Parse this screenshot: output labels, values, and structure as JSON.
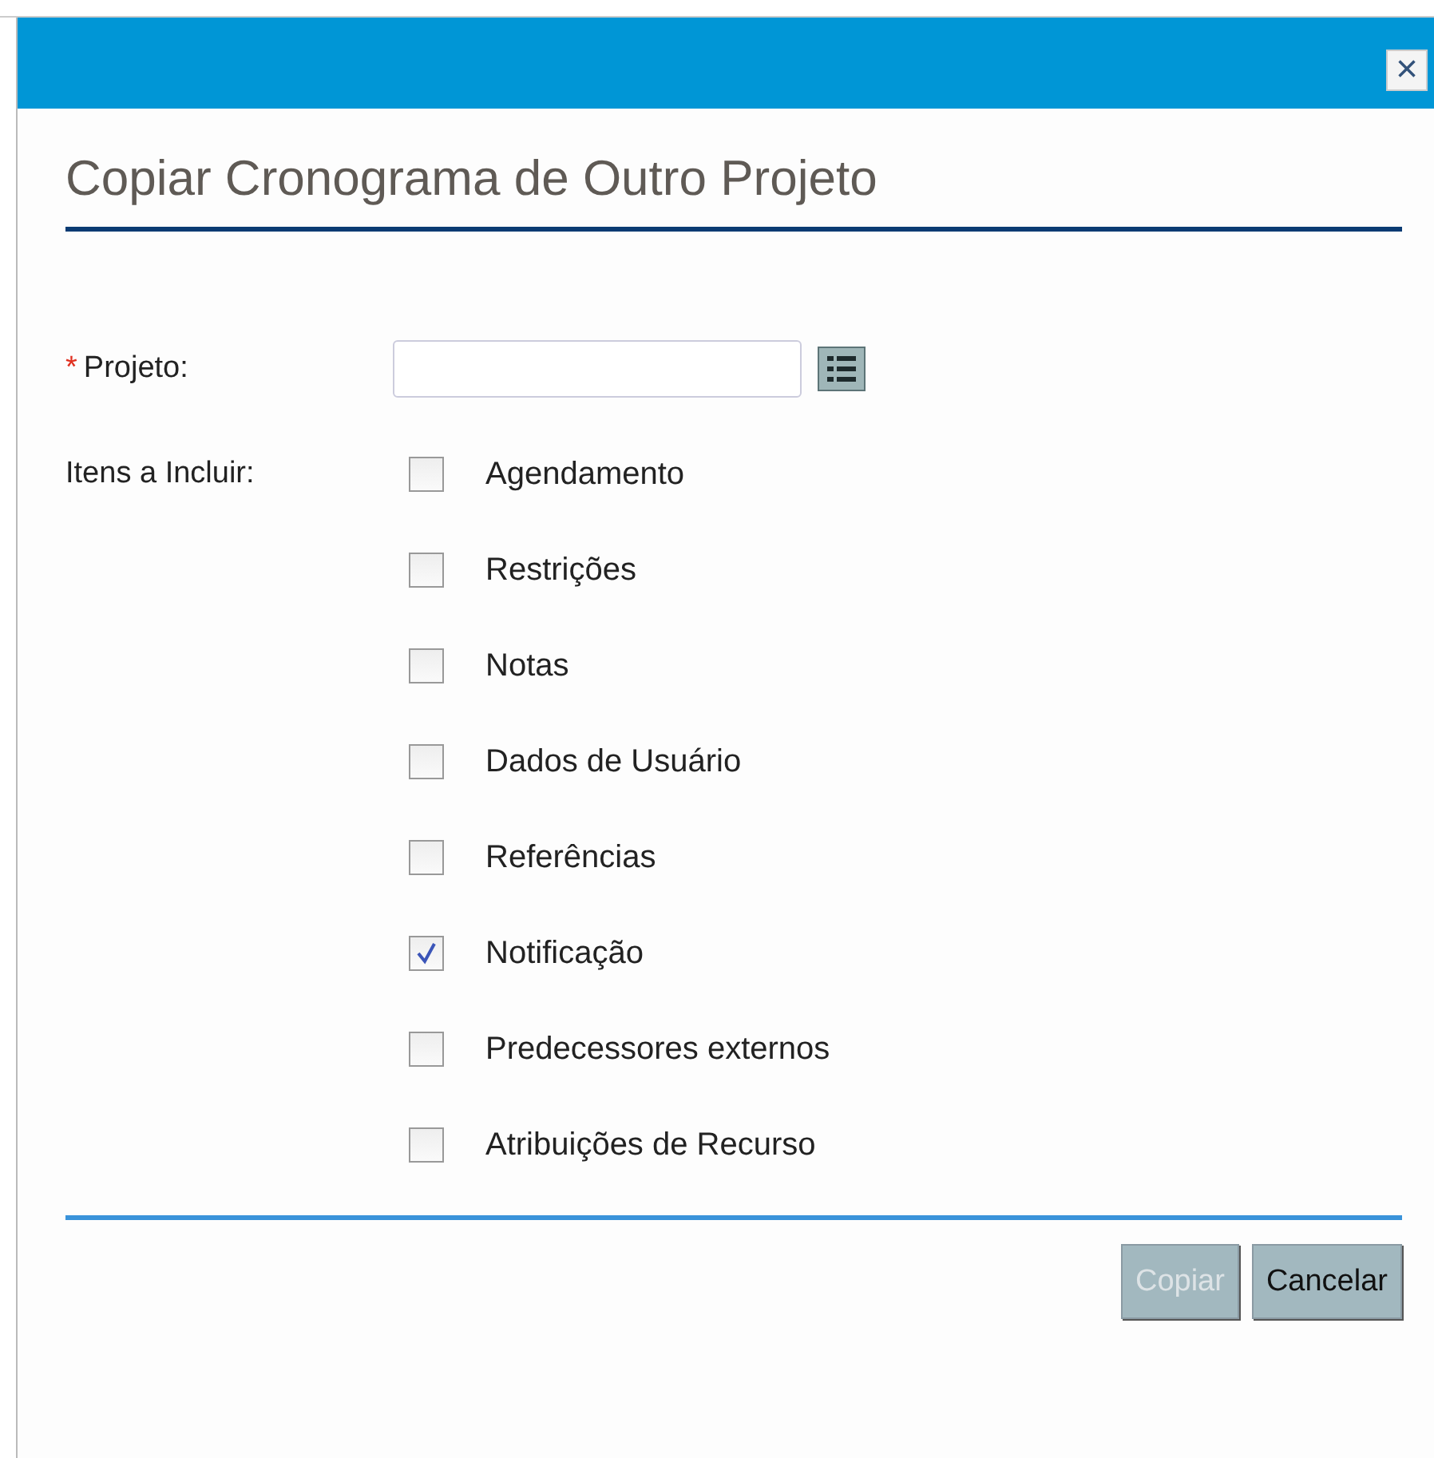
{
  "dialog": {
    "title": "Copiar Cronograma de Outro Projeto",
    "close": "×"
  },
  "project": {
    "required_mark": "*",
    "label": "Projeto:"
  },
  "items_label": "Itens a Incluir:",
  "items": [
    {
      "label": "Agendamento",
      "checked": false
    },
    {
      "label": "Restrições",
      "checked": false
    },
    {
      "label": "Notas",
      "checked": false
    },
    {
      "label": "Dados de Usuário",
      "checked": false
    },
    {
      "label": "Referências",
      "checked": false
    },
    {
      "label": "Notificação",
      "checked": true
    },
    {
      "label": "Predecessores externos",
      "checked": false
    },
    {
      "label": "Atribuições de Recurso",
      "checked": false
    }
  ],
  "buttons": [
    {
      "label": "Copiar",
      "disabled": true
    },
    {
      "label": "Cancelar",
      "disabled": false
    }
  ]
}
